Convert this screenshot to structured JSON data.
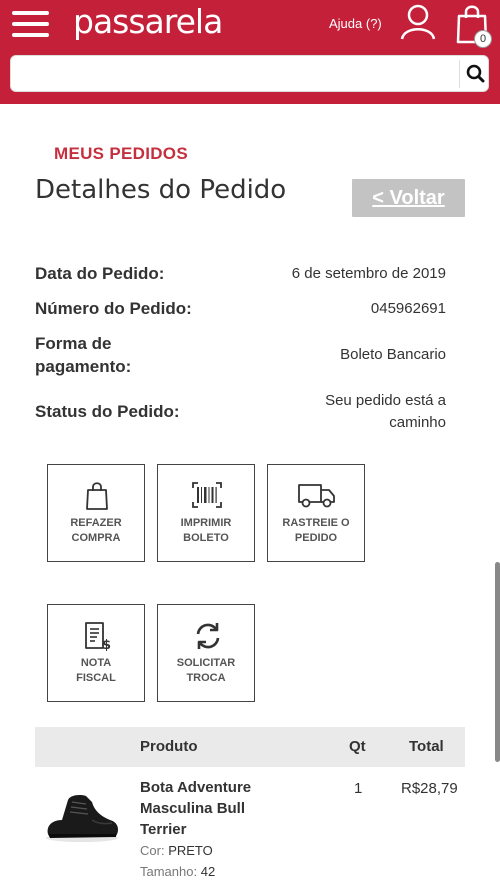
{
  "header": {
    "logo": "passarela",
    "help_link": "Ajuda (?)",
    "cart_count": "0"
  },
  "search": {
    "placeholder": "",
    "value": ""
  },
  "page": {
    "section_label": "MEUS PEDIDOS",
    "title": "Detalhes do Pedido",
    "back_label": "< Voltar"
  },
  "order": {
    "date_label": "Data do Pedido:",
    "date_value": "6 de setembro de 2019",
    "number_label": "Número do Pedido:",
    "number_value": "045962691",
    "payment_label_line1": "Forma de",
    "payment_label_line2": "pagamento:",
    "payment_value": "Boleto Bancario",
    "status_label": "Status do Pedido:",
    "status_value_line1": "Seu pedido está a",
    "status_value_line2": "caminho"
  },
  "actions": [
    {
      "line1": "REFAZER",
      "line2": "COMPRA",
      "icon": "shopping-bag-icon"
    },
    {
      "line1": "IMPRIMIR",
      "line2": "BOLETO",
      "icon": "barcode-icon"
    },
    {
      "line1": "RASTREIE O",
      "line2": "PEDIDO",
      "icon": "truck-icon"
    },
    {
      "line1": "NOTA",
      "line2": "FISCAL",
      "icon": "invoice-icon"
    },
    {
      "line1": "SOLICITAR",
      "line2": "TROCA",
      "icon": "exchange-icon"
    }
  ],
  "table": {
    "headers": {
      "product": "Produto",
      "qty": "Qt",
      "total": "Total"
    },
    "items": [
      {
        "name": "Bota Adventure Masculina Bull Terrier",
        "color_label": "Cor:",
        "color_value": "PRETO",
        "size_label": "Tamanho:",
        "size_value": "42",
        "qty": "1",
        "total": "R$28,79",
        "image": "black-boot-image"
      }
    ]
  },
  "colors": {
    "brand": "#c5203a",
    "accent_text": "#c5303f",
    "button_gray": "#c3c3c3",
    "table_head": "#eaeaea"
  }
}
